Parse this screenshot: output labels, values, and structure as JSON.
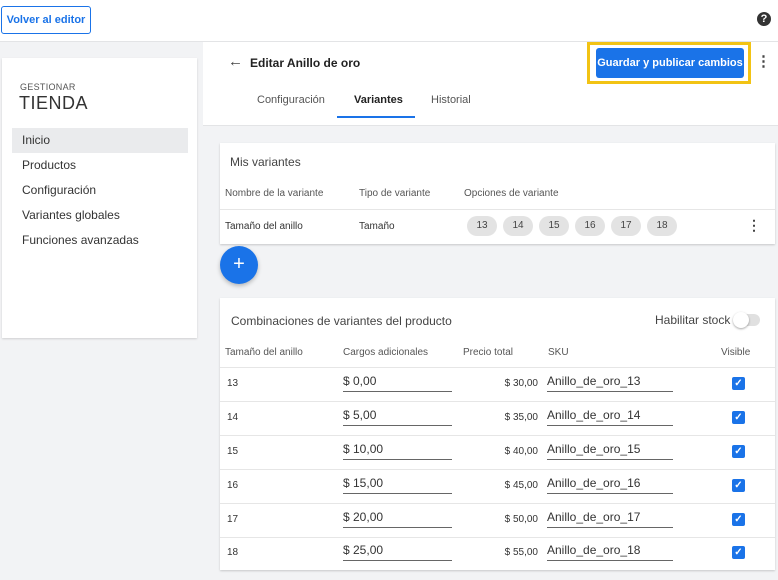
{
  "topbar": {
    "back_label": "Volver al editor",
    "help_icon": "?"
  },
  "header": {
    "title": "Editar Anillo de oro",
    "back_icon": "←",
    "publish_label": "Guardar y publicar cambios",
    "menu_icon": "⋮",
    "tabs": [
      {
        "label": "Configuración"
      },
      {
        "label": "Variantes"
      },
      {
        "label": "Historial"
      }
    ]
  },
  "sidebar": {
    "subtitle": "GESTIONAR",
    "title": "TIENDA",
    "items": [
      {
        "label": "Inicio"
      },
      {
        "label": "Productos"
      },
      {
        "label": "Configuración"
      },
      {
        "label": "Variantes globales"
      },
      {
        "label": "Funciones avanzadas"
      }
    ]
  },
  "variants": {
    "title": "Mis variantes",
    "columns": [
      "Nombre de la variante",
      "Tipo de variante",
      "Opciones de variante"
    ],
    "row": {
      "name": "Tamaño del anillo",
      "type": "Tamaño",
      "options": [
        "13",
        "14",
        "15",
        "16",
        "17",
        "18"
      ],
      "menu_icon": "⋮"
    },
    "add_icon": "+"
  },
  "combinations": {
    "title": "Combinaciones de variantes del producto",
    "stock_label": "Habilitar stock",
    "columns": [
      "Tamaño del anillo",
      "Cargos adicionales",
      "Precio total",
      "SKU",
      "Visible"
    ],
    "check_icon": "✓",
    "rows": [
      {
        "size": "13",
        "charge": "$ 0,00",
        "total": "$ 30,00",
        "sku": "Anillo_de_oro_13"
      },
      {
        "size": "14",
        "charge": "$ 5,00",
        "total": "$ 35,00",
        "sku": "Anillo_de_oro_14"
      },
      {
        "size": "15",
        "charge": "$ 10,00",
        "total": "$ 40,00",
        "sku": "Anillo_de_oro_15"
      },
      {
        "size": "16",
        "charge": "$ 15,00",
        "total": "$ 45,00",
        "sku": "Anillo_de_oro_16"
      },
      {
        "size": "17",
        "charge": "$ 20,00",
        "total": "$ 50,00",
        "sku": "Anillo_de_oro_17"
      },
      {
        "size": "18",
        "charge": "$ 25,00",
        "total": "$ 55,00",
        "sku": "Anillo_de_oro_18"
      }
    ]
  }
}
